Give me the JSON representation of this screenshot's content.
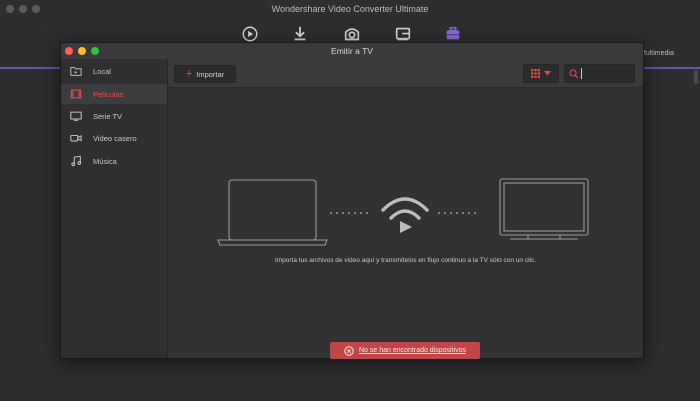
{
  "app": {
    "title": "Wondershare Video Converter Ultimate",
    "right_label": "Multimedia"
  },
  "toolbar": {
    "icons": [
      "convert-icon",
      "download-icon",
      "burn-icon",
      "transfer-icon",
      "toolbox-icon"
    ],
    "accent_color": "#7b5bd0"
  },
  "dialog": {
    "title": "Emitir a TV"
  },
  "sidebar": {
    "items": [
      {
        "label": "Local",
        "icon": "folder-icon"
      },
      {
        "label": "Películas",
        "icon": "film-icon"
      },
      {
        "label": "Serie TV",
        "icon": "tv-icon"
      },
      {
        "label": "Video casero",
        "icon": "camcorder-icon"
      },
      {
        "label": "Música",
        "icon": "music-icon"
      }
    ],
    "active_index": 1,
    "active_color": "#e95050"
  },
  "content": {
    "import_label": "Importar",
    "search_placeholder": "",
    "info_text": "Importa tus archivos de video aquí y transmítelos en flujo continuo a la TV sólo con un clic.",
    "warning_text": "No se han encontrado dispositivos",
    "warning_color": "#c14646"
  }
}
